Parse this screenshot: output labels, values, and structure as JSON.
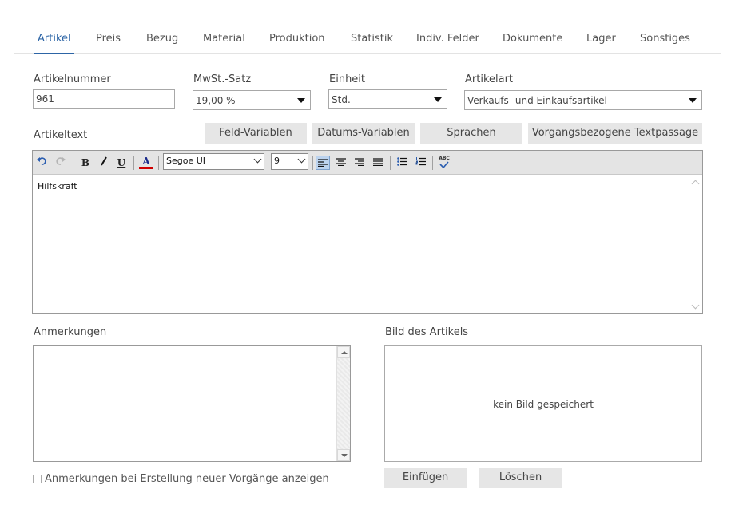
{
  "tabs": [
    {
      "label": "Artikel",
      "active": true
    },
    {
      "label": "Preis"
    },
    {
      "label": "Bezug"
    },
    {
      "label": "Material"
    },
    {
      "label": "Produktion"
    },
    {
      "label": "Statistik"
    },
    {
      "label": "Indiv. Felder"
    },
    {
      "label": "Dokumente"
    },
    {
      "label": "Lager"
    },
    {
      "label": "Sonstiges"
    }
  ],
  "fields": {
    "artikelnummer": {
      "label": "Artikelnummer",
      "value": "961"
    },
    "mwst": {
      "label": "MwSt.-Satz",
      "value": "19,00 %"
    },
    "einheit": {
      "label": "Einheit",
      "value": "Std."
    },
    "artikelart": {
      "label": "Artikelart",
      "value": "Verkaufs- und Einkaufsartikel"
    }
  },
  "artikeltext": {
    "label": "Artikeltext",
    "buttons": {
      "feld_variablen": "Feld-Variablen",
      "datums_variablen": "Datums-Variablen",
      "sprachen": "Sprachen",
      "vorgang": "Vorgangsbezogene Textpassage"
    },
    "toolbar": {
      "bold": "B",
      "italic": "I",
      "underline": "U",
      "font_color": "A",
      "font": "Segoe UI",
      "size": "9",
      "spellcheck": "ABC"
    },
    "content": "Hilfskraft"
  },
  "anmerkungen": {
    "label": "Anmerkungen",
    "checkbox_label": "Anmerkungen bei Erstellung neuer Vorgänge anzeigen"
  },
  "bild": {
    "label": "Bild des Artikels",
    "empty_text": "kein Bild gespeichert",
    "insert_label": "Einfügen",
    "delete_label": "Löschen"
  },
  "colors": {
    "accent": "#2d65a6",
    "button_bg": "#e6e6e6",
    "font_color_bar": "#d00000"
  }
}
